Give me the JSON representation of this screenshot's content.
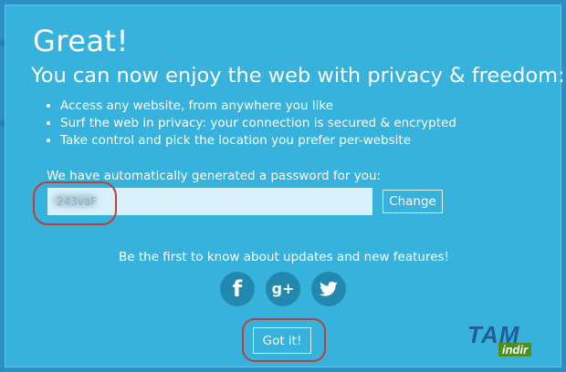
{
  "modal": {
    "title": "Great!",
    "subtitle": "You can now enjoy the web with privacy & freedom:",
    "features": [
      "Access any website, from anywhere you like",
      "Surf the web in privacy: your connection is secured & encrypted",
      "Take control and pick the location you prefer per-website"
    ],
    "password_label": "We have automatically generated a password for you:",
    "password_value": "243vaF",
    "change_label": "Change",
    "newsletter_text": "Be the first to know about updates and new features!",
    "social": [
      {
        "name": "facebook",
        "glyph": "f",
        "icon": "facebook-icon"
      },
      {
        "name": "google-plus",
        "glyph": "g+",
        "icon": "google-plus-icon"
      },
      {
        "name": "twitter",
        "icon": "twitter-icon"
      }
    ],
    "got_it_label": "Got it!"
  },
  "watermark": {
    "main": "TAM",
    "sub": "indir"
  },
  "colors": {
    "modal_bg": "#36b2dd",
    "social_bg": "#2388b0",
    "highlight_circle": "#b8413a"
  }
}
